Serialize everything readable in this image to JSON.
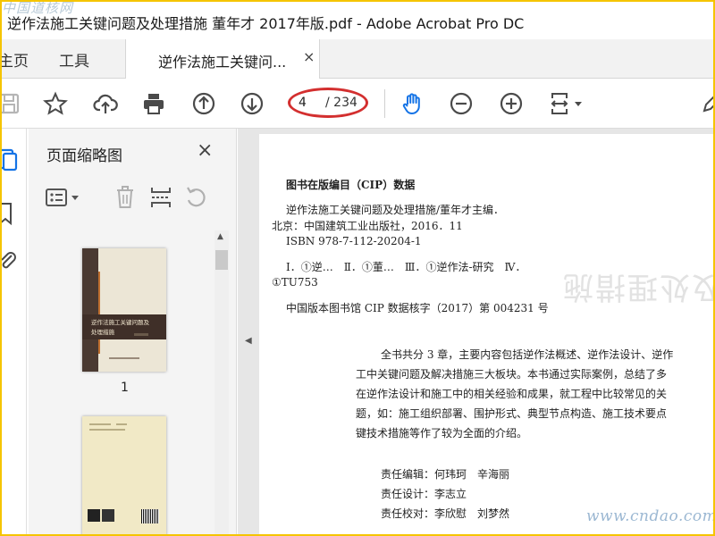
{
  "window": {
    "title": "逆作法施工关键问题及处理措施 董年才 2017年版.pdf - Adobe Acrobat Pro DC"
  },
  "watermarks": {
    "top_left": "中国道核网",
    "bottom_right": "www.cndao.com"
  },
  "nav": {
    "home_label": "主页",
    "tools_label": "工具",
    "doc_tab_label": "逆作法施工关键问...",
    "doc_tab_close": "×"
  },
  "toolbar": {
    "current_page": "4",
    "total_pages": "/ 234",
    "icons": [
      "save-icon",
      "star-icon",
      "upload-cloud-icon",
      "print-icon",
      "page-up-icon",
      "page-down-icon",
      "hand-icon",
      "zoom-out-icon",
      "zoom-in-icon",
      "fit-page-icon",
      "pen-icon"
    ],
    "accent_color": "#1473e6",
    "highlight_color": "#d32f2f"
  },
  "thumbnails_panel": {
    "title": "页面缩略图",
    "close": "×",
    "thumbnails": [
      {
        "label": "1",
        "cover_title_line1": "逆作法施工关键问题及",
        "cover_title_line2": "处理措施"
      },
      {
        "label": ""
      }
    ]
  },
  "document": {
    "lines": [
      "图书在版编目（CIP）数据",
      "逆作法施工关键问题及处理措施/董年才主编．",
      "北京：中国建筑工业出版社，2016．11",
      "ISBN 978-7-112-20204-1",
      "Ⅰ．①逆…　Ⅱ．①董…　Ⅲ．①逆作法-研究　Ⅳ．",
      "①TU753",
      "中国版本图书馆 CIP 数据核字（2017）第 004231 号",
      "全书共分 3 章，主要内容包括逆作法概述、逆作法设计、逆作",
      "工中关键问题及解决措施三大板块。本书通过实际案例，总结了多",
      "在逆作法设计和施工中的相关经验和成果，就工程中比较常见的关",
      "题，如：施工组织部署、围护形式、典型节点构造、施工技术要点",
      "键技术措施等作了较为全面的介绍。",
      "责任编辑：何玮珂　辛海丽",
      "责任设计：李志立",
      "责任校对：李欣慰　刘梦然"
    ],
    "ghost_text": "键问题及处理措施"
  }
}
